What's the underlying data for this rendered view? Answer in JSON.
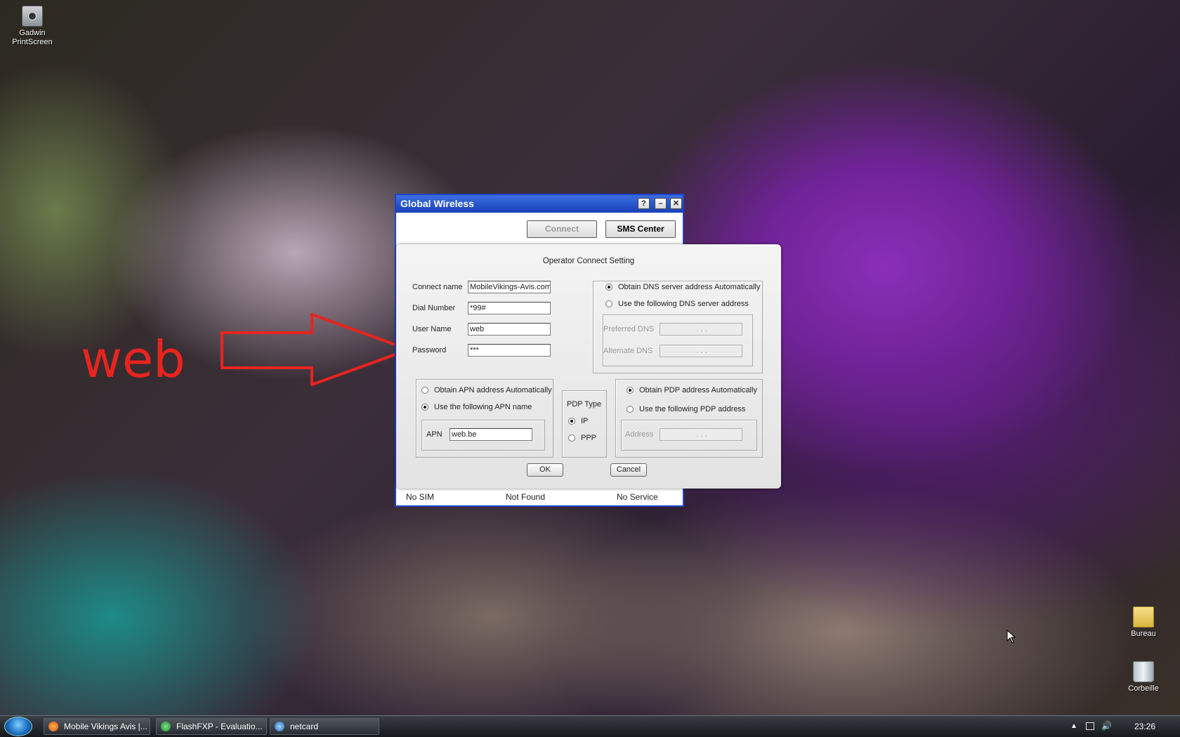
{
  "desktop": {
    "icons": [
      {
        "label_line1": "Gadwin",
        "label_line2": "PrintScreen",
        "icon": "camera-icon"
      },
      {
        "label": "Bureau",
        "icon": "folder-icon"
      },
      {
        "label": "Corbeille",
        "icon": "recycle-bin-icon"
      }
    ]
  },
  "annotation": {
    "text": "web",
    "color": "#e8241f"
  },
  "app": {
    "title": "Global  Wireless",
    "help_btn": "?",
    "min_btn": "–",
    "close_btn": "✕",
    "connect_label": "Connect",
    "sms_label": "SMS Center",
    "status": {
      "sim": "No SIM",
      "device": "Not Found",
      "service": "No Service"
    }
  },
  "dialog": {
    "title": "Operator Connect Setting",
    "connect_name_label": "Connect name",
    "connect_name_value": "MobileVikings-Avis.com",
    "dial_number_label": "Dial Number",
    "dial_number_value": "*99#",
    "user_name_label": "User Name",
    "user_name_value": "web",
    "password_label": "Password",
    "password_value": "***",
    "dns_auto_label": "Obtain DNS server address Automatically",
    "dns_manual_label": "Use the following DNS server address",
    "preferred_dns_label": "Preferred DNS",
    "alternate_dns_label": "Alternate DNS",
    "ip_placeholder": ".      .      .",
    "apn_auto_label": "Obtain APN address Automatically",
    "apn_manual_label": "Use the following APN name",
    "apn_label": "APN",
    "apn_value": "web.be",
    "pdp_type_label": "PDP Type",
    "pdp_ip_label": "IP",
    "pdp_ppp_label": "PPP",
    "pdp_auto_label": "Obtain PDP address Automatically",
    "pdp_manual_label": "Use the following PDP address",
    "address_label": "Address",
    "ok_label": "OK",
    "cancel_label": "Cancel"
  },
  "taskbar": {
    "tasks": [
      {
        "label": "Mobile Vikings Avis |...",
        "icon": "firefox-icon"
      },
      {
        "label": "FlashFXP - Evaluatio...",
        "icon": "flashfxp-icon"
      },
      {
        "label": "netcard",
        "icon": "netcard-icon"
      }
    ],
    "clock": "23:26"
  }
}
